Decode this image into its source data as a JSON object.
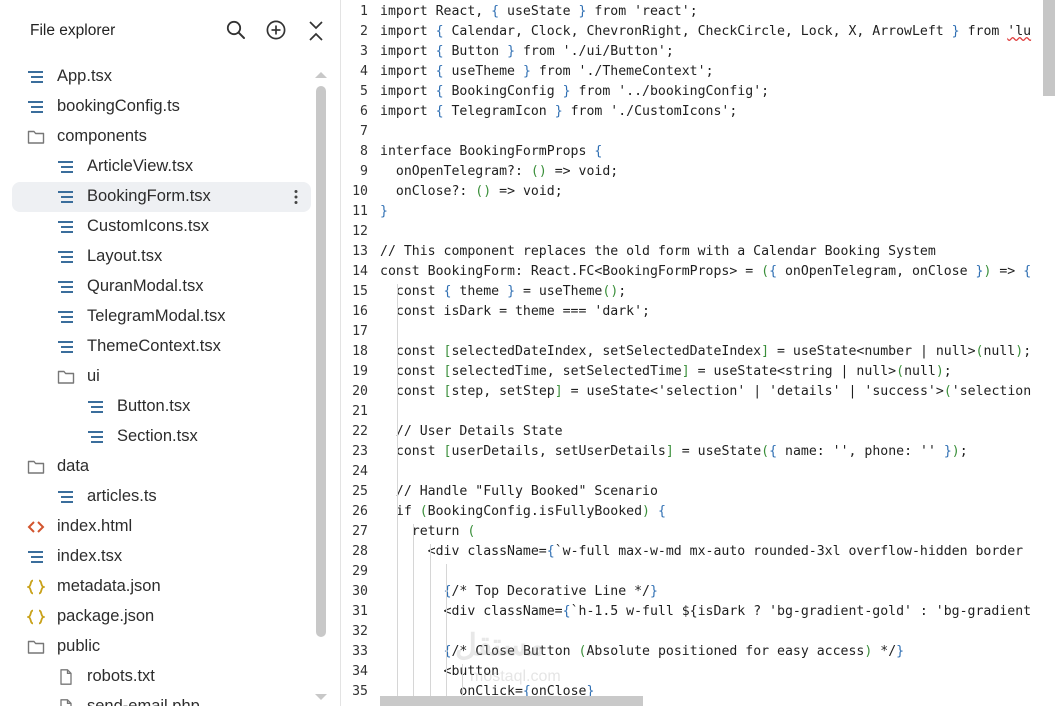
{
  "sidebar": {
    "title": "File explorer",
    "header_icons": [
      "search-icon",
      "add-circle-icon",
      "collapse-all-icon"
    ],
    "items": [
      {
        "name": "App.tsx",
        "icon": "file-lines-icon",
        "depth": 0
      },
      {
        "name": "bookingConfig.ts",
        "icon": "file-lines-icon",
        "depth": 0
      },
      {
        "name": "components",
        "icon": "folder-icon",
        "depth": 0
      },
      {
        "name": "ArticleView.tsx",
        "icon": "file-lines-icon",
        "depth": 1
      },
      {
        "name": "BookingForm.tsx",
        "icon": "file-lines-icon",
        "depth": 1,
        "selected": true
      },
      {
        "name": "CustomIcons.tsx",
        "icon": "file-lines-icon",
        "depth": 1
      },
      {
        "name": "Layout.tsx",
        "icon": "file-lines-icon",
        "depth": 1
      },
      {
        "name": "QuranModal.tsx",
        "icon": "file-lines-icon",
        "depth": 1
      },
      {
        "name": "TelegramModal.tsx",
        "icon": "file-lines-icon",
        "depth": 1
      },
      {
        "name": "ThemeContext.tsx",
        "icon": "file-lines-icon",
        "depth": 1
      },
      {
        "name": "ui",
        "icon": "folder-icon",
        "depth": 1
      },
      {
        "name": "Button.tsx",
        "icon": "file-lines-icon",
        "depth": 2
      },
      {
        "name": "Section.tsx",
        "icon": "file-lines-icon",
        "depth": 2
      },
      {
        "name": "data",
        "icon": "folder-icon",
        "depth": 0
      },
      {
        "name": "articles.ts",
        "icon": "file-lines-icon",
        "depth": 1
      },
      {
        "name": "index.html",
        "icon": "code-brackets-icon",
        "depth": 0
      },
      {
        "name": "index.tsx",
        "icon": "file-lines-icon",
        "depth": 0
      },
      {
        "name": "metadata.json",
        "icon": "json-braces-icon",
        "depth": 0
      },
      {
        "name": "package.json",
        "icon": "json-braces-icon",
        "depth": 0
      },
      {
        "name": "public",
        "icon": "folder-icon",
        "depth": 0
      },
      {
        "name": "robots.txt",
        "icon": "file-icon",
        "depth": 1
      },
      {
        "name": "send-email.php",
        "icon": "file-icon",
        "depth": 1
      }
    ]
  },
  "editor": {
    "lines": [
      "import React, { useState } from 'react';",
      "import { Calendar, Clock, ChevronRight, CheckCircle, Lock, X, ArrowLeft } from 'lu",
      "import { Button } from './ui/Button';",
      "import { useTheme } from './ThemeContext';",
      "import { BookingConfig } from '../bookingConfig';",
      "import { TelegramIcon } from './CustomIcons';",
      "",
      "interface BookingFormProps {",
      "  onOpenTelegram?: () => void;",
      "  onClose?: () => void;",
      "}",
      "",
      "// This component replaces the old form with a Calendar Booking System",
      "const BookingForm: React.FC<BookingFormProps> = ({ onOpenTelegram, onClose }) => {",
      "  const { theme } = useTheme();",
      "  const isDark = theme === 'dark';",
      "",
      "  const [selectedDateIndex, setSelectedDateIndex] = useState<number | null>(null);",
      "  const [selectedTime, setSelectedTime] = useState<string | null>(null);",
      "  const [step, setStep] = useState<'selection' | 'details' | 'success'>('selection",
      "",
      "  // User Details State",
      "  const [userDetails, setUserDetails] = useState({ name: '', phone: '' });",
      "",
      "  // Handle \"Fully Booked\" Scenario",
      "  if (BookingConfig.isFullyBooked) {",
      "    return (",
      "      <div className={`w-full max-w-md mx-auto rounded-3xl overflow-hidden border",
      "",
      "        {/* Top Decorative Line */}",
      "        <div className={`h-1.5 w-full ${isDark ? 'bg-gradient-gold' : 'bg-gradient",
      "",
      "        {/* Close Button (Absolute positioned for easy access) */}",
      "        <button",
      "          onClick={onClose}"
    ]
  },
  "watermark": {
    "main": "مستقل",
    "sub": "mostaql.com"
  }
}
